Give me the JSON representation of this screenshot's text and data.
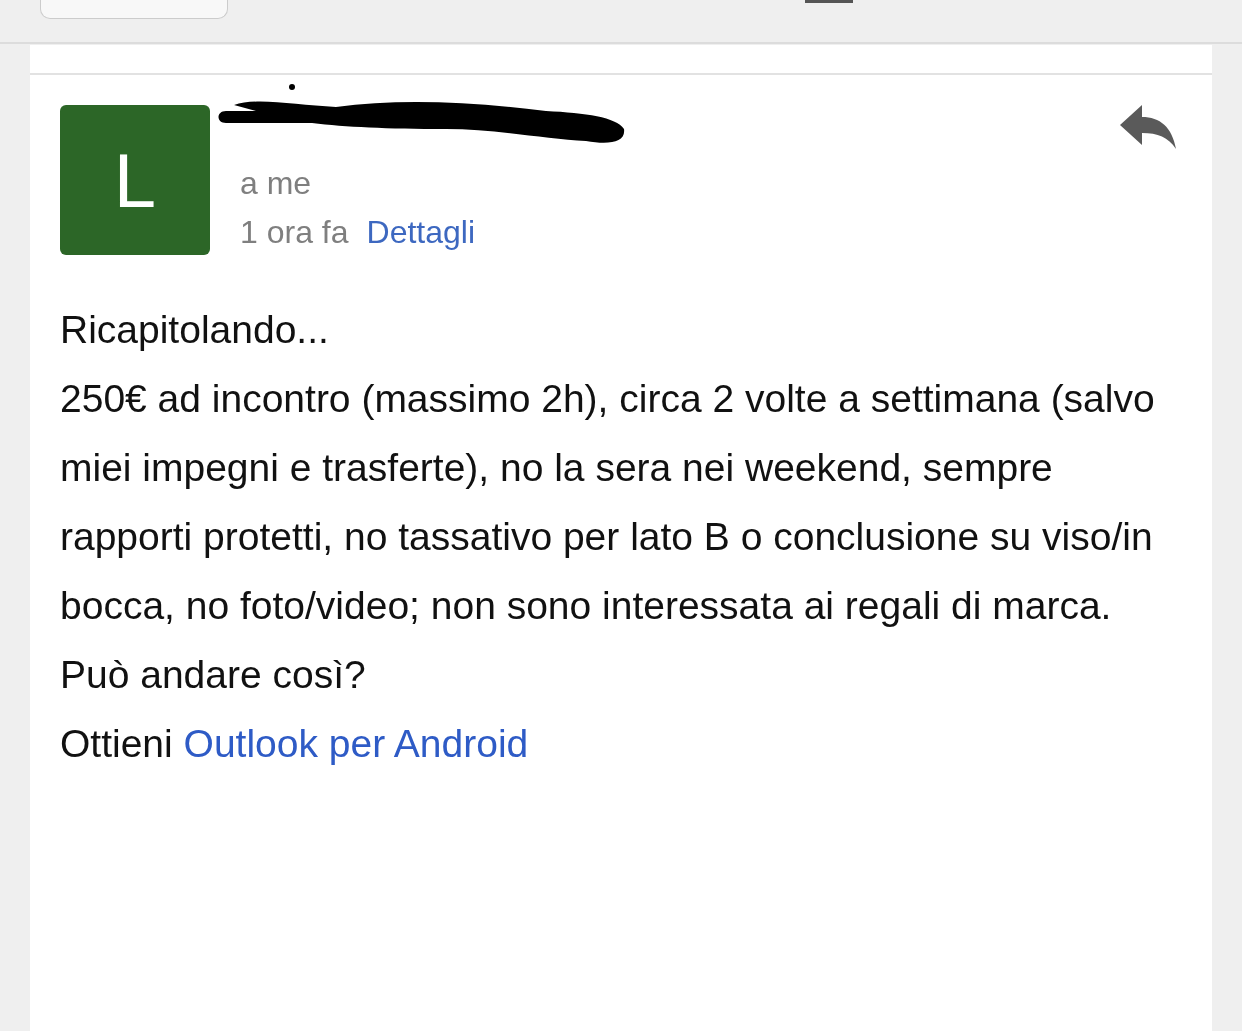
{
  "message": {
    "avatar_letter": "L",
    "recipient": "a me",
    "time": "1 ora fa",
    "details_link": "Dettagli",
    "sender_redacted": true
  },
  "body": [
    "Ricapitolando...",
    "250€ ad incontro (massimo 2h), circa 2 volte a settimana (salvo miei impegni e trasferte), no la sera nei weekend, sempre rapporti protetti, no tassativo per lato B o conclusione su viso/in bocca, no foto/video; non sono interessata ai regali di marca.",
    "Può andare così?"
  ],
  "signature": {
    "text": "Ottieni",
    "link": "Outlook per Android"
  }
}
